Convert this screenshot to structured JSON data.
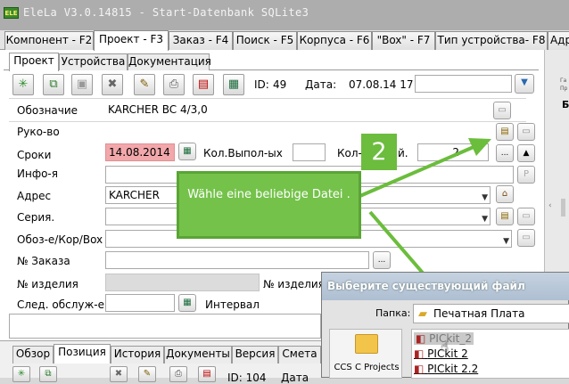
{
  "window": {
    "logo": "ELE",
    "title": "EleLa V3.0.14815 - Start-Datenbank SQLite3"
  },
  "main_tabs": [
    "Компонент - F2",
    "Проект - F3",
    "Заказ - F4",
    "Поиск - F5",
    "Корпуса - F6",
    "\"Box\" - F7",
    "Тип устройства- F8",
    "Адр"
  ],
  "sub_tabs": [
    "Проект",
    "Устройства",
    "Документация"
  ],
  "toolbar": {
    "id_label": "ID:",
    "id_value": "49",
    "date_label": "Дата:",
    "date_value": "07.08.14 17"
  },
  "form": {
    "designation_label": "Обозначие",
    "designation_value": "KARCHER BC 4/3,0",
    "manager_label": "Руко-во",
    "deadline_label": "Сроки",
    "deadline_value": "14.08.2014",
    "count_done_label": "Кол.Выпол-ых",
    "count_label": "Кол-",
    "count_label_tail": "й.",
    "count_value": "2",
    "info_label": "Инфо-я",
    "address_label": "Адрес",
    "address_value": "KARCHER",
    "series_label": "Серия.",
    "designation_box_label": "Обоз-е/Кор/Box",
    "order_label": "№ Заказа",
    "item_no_label": "№ изделия",
    "item_no_label2": "№ изделия",
    "next_service_label": "След. обслуж-е",
    "interval_label": "Интервал",
    "more_button": "..."
  },
  "bottom_tabs": [
    "Обзор",
    "Позиция",
    "История",
    "Документы",
    "Версия",
    "Смета"
  ],
  "bottom_toolbar": {
    "id_label": "ID: 104",
    "date_label": "Дата"
  },
  "right_panel": {
    "text1": "Га",
    "text2": "Пр",
    "text3": "Б"
  },
  "callout": {
    "text": "Wähle eine beliebige Datei .",
    "step": "2"
  },
  "dialog": {
    "title": "Выберите существующий файл",
    "folder_label": "Папка:",
    "folder_value": "Печатная Плата",
    "place": "CCS C Projects",
    "files": [
      "PICkit_2",
      "PICkit 2",
      "PICkit 2.2"
    ]
  },
  "colors": {
    "callout": "#74c24a",
    "deadline_bg": "#f2a7aa",
    "title_bar": "#adadad"
  }
}
